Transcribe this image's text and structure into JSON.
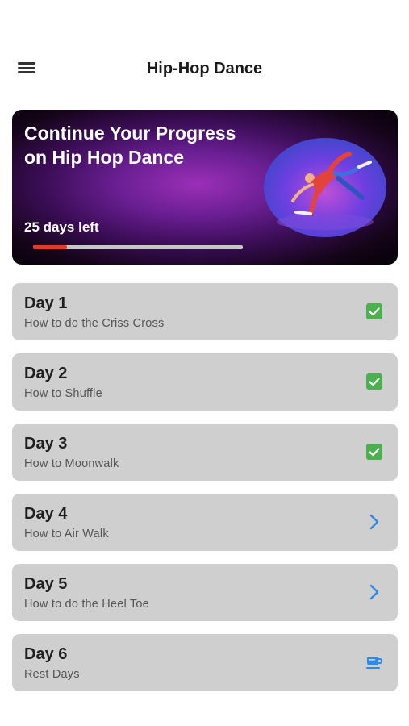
{
  "header": {
    "title": "Hip-Hop Dance",
    "menu_icon": "hamburger-menu-icon"
  },
  "hero": {
    "title": "Continue Your Progress on Hip Hop Dance",
    "days_left": "25 days left",
    "progress_fraction": 0.16,
    "image": "breakdancer-photo",
    "colors": {
      "progress": "#e03a2c",
      "track": "#c7c7c7",
      "background": "#6a1f93"
    }
  },
  "days": [
    {
      "title": "Day 1",
      "subtitle": "How to do the Criss Cross",
      "status": "completed",
      "icon": "checkbox-checked-icon"
    },
    {
      "title": "Day 2",
      "subtitle": "How to Shuffle",
      "status": "completed",
      "icon": "checkbox-checked-icon"
    },
    {
      "title": "Day 3",
      "subtitle": "How to Moonwalk",
      "status": "completed",
      "icon": "checkbox-checked-icon"
    },
    {
      "title": "Day 4",
      "subtitle": "How to Air Walk",
      "status": "pending",
      "icon": "chevron-right-icon"
    },
    {
      "title": "Day 5",
      "subtitle": "How to do the Heel Toe",
      "status": "pending",
      "icon": "chevron-right-icon"
    },
    {
      "title": "Day 6",
      "subtitle": "Rest Days",
      "status": "rest",
      "icon": "coffee-cup-icon"
    }
  ],
  "colors": {
    "check": "#4caf50",
    "chevron": "#2f8ae5",
    "card": "#cfcfcf"
  }
}
